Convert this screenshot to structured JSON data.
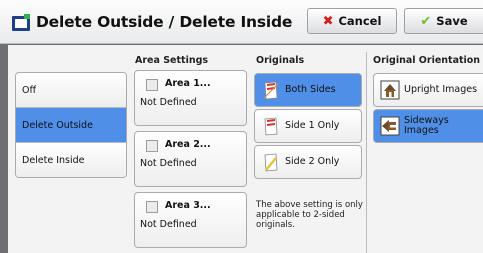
{
  "title": "Delete Outside / Delete Inside",
  "buttons": {
    "cancel": "Cancel",
    "save": "Save"
  },
  "sections": {
    "area_settings": "Area Settings",
    "originals": "Originals",
    "orientation": "Original Orientation"
  },
  "modes": [
    {
      "label": "Off",
      "selected": false
    },
    {
      "label": "Delete Outside",
      "selected": true
    },
    {
      "label": "Delete Inside",
      "selected": false
    }
  ],
  "areas": [
    {
      "label": "Area 1...",
      "value": "Not Defined"
    },
    {
      "label": "Area 2...",
      "value": "Not Defined"
    },
    {
      "label": "Area 3...",
      "value": "Not Defined"
    }
  ],
  "originals": [
    {
      "label": "Both Sides",
      "selected": true,
      "icon": "both-sides-icon"
    },
    {
      "label": "Side 1 Only",
      "selected": false,
      "icon": "side-1-only-icon"
    },
    {
      "label": "Side 2 Only",
      "selected": false,
      "icon": "side-2-only-icon"
    }
  ],
  "note": "The above setting is only applicable to 2-sided originals.",
  "orientations": [
    {
      "label": "Upright Images",
      "selected": false,
      "icon": "upright-images-icon"
    },
    {
      "label_line1": "Sideways",
      "label_line2": "Images",
      "selected": true,
      "icon": "sideways-images-icon"
    }
  ],
  "colors": {
    "selected": "#4f8fe8",
    "cancel_icon": "#d11f1f",
    "save_icon": "#6abf2a"
  }
}
